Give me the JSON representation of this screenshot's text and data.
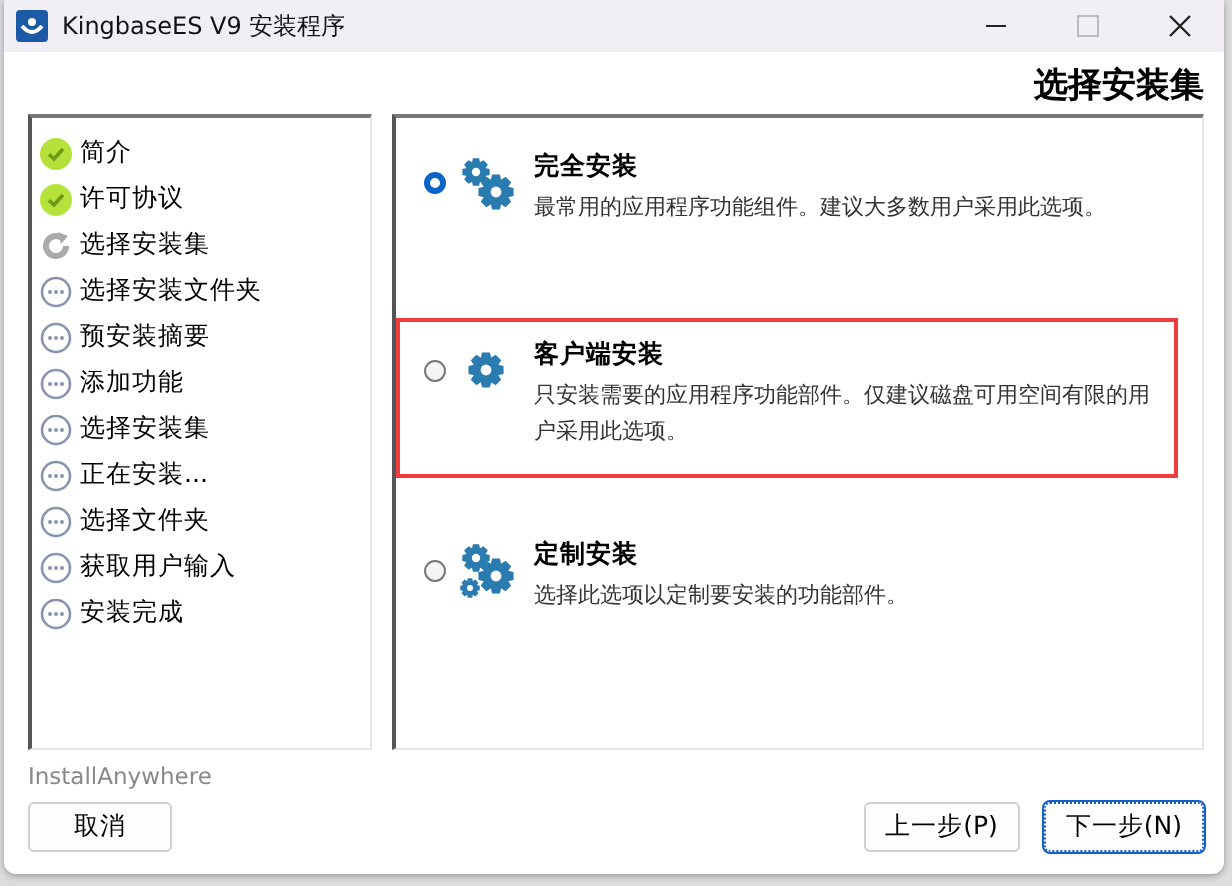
{
  "window": {
    "title": "KingbaseES V9 安装程序"
  },
  "heading": "选择安装集",
  "steps": [
    {
      "label": "简介",
      "kind": "done"
    },
    {
      "label": "许可协议",
      "kind": "done"
    },
    {
      "label": "选择安装集",
      "kind": "current"
    },
    {
      "label": "选择安装文件夹",
      "kind": "pending"
    },
    {
      "label": "预安装摘要",
      "kind": "pending"
    },
    {
      "label": "添加功能",
      "kind": "pending"
    },
    {
      "label": "选择安装集",
      "kind": "pending"
    },
    {
      "label": "正在安装...",
      "kind": "pending"
    },
    {
      "label": "选择文件夹",
      "kind": "pending"
    },
    {
      "label": "获取用户输入",
      "kind": "pending"
    },
    {
      "label": "安装完成",
      "kind": "pending"
    }
  ],
  "options": [
    {
      "title": "完全安装",
      "description": "最常用的应用程序功能组件。建议大多数用户采用此选项。",
      "selected": true,
      "highlighted": false,
      "kind": "gears"
    },
    {
      "title": "客户端安装",
      "description": "只安装需要的应用程序功能部件。仅建议磁盘可用空间有限的用户采用此选项。",
      "selected": false,
      "highlighted": true,
      "kind": "gear"
    },
    {
      "title": "定制安装",
      "description": "选择此选项以定制要安装的功能部件。",
      "selected": false,
      "highlighted": false,
      "kind": "gears3"
    }
  ],
  "vendor": "InstallAnywhere",
  "buttons": [
    {
      "label": "取消",
      "focused": false
    },
    {
      "label": "上一步(P)",
      "focused": false
    },
    {
      "label": "下一步(N)",
      "focused": true
    }
  ]
}
